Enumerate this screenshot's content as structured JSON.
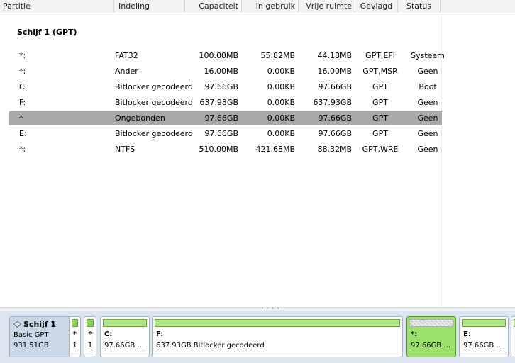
{
  "columns": [
    "Partitie",
    "Indeling",
    "Capaciteit",
    "In gebruik",
    "Vrije ruimte",
    "Gevlagd",
    "Status"
  ],
  "disk_title": "Schijf 1 (GPT)",
  "rows": [
    {
      "partition": "*:",
      "format": "FAT32",
      "capacity": "100.00MB",
      "used": "55.82MB",
      "free": "44.18MB",
      "flags": "GPT,EFI",
      "status": "Systeem",
      "selected": false
    },
    {
      "partition": "*:",
      "format": "Ander",
      "capacity": "16.00MB",
      "used": "0.00KB",
      "free": "16.00MB",
      "flags": "GPT,MSR",
      "status": "Geen",
      "selected": false
    },
    {
      "partition": "C:",
      "format": "Bitlocker gecodeerd",
      "capacity": "97.66GB",
      "used": "0.00KB",
      "free": "97.66GB",
      "flags": "GPT",
      "status": "Boot",
      "selected": false
    },
    {
      "partition": "F:",
      "format": "Bitlocker gecodeerd",
      "capacity": "637.93GB",
      "used": "0.00KB",
      "free": "637.93GB",
      "flags": "GPT",
      "status": "Geen",
      "selected": false
    },
    {
      "partition": "*",
      "format": "Ongebonden",
      "capacity": "97.66GB",
      "used": "0.00KB",
      "free": "97.66GB",
      "flags": "GPT",
      "status": "Geen",
      "selected": true
    },
    {
      "partition": "E:",
      "format": "Bitlocker gecodeerd",
      "capacity": "97.66GB",
      "used": "0.00KB",
      "free": "97.66GB",
      "flags": "GPT",
      "status": "Geen",
      "selected": false
    },
    {
      "partition": "*:",
      "format": "NTFS",
      "capacity": "510.00MB",
      "used": "421.68MB",
      "free": "88.32MB",
      "flags": "GPT,WRE",
      "status": "Geen",
      "selected": false
    }
  ],
  "diskmap": {
    "disk": {
      "name": "Schijf 1",
      "type": "Basic GPT",
      "size": "931.51GB",
      "icon": "disk-icon"
    },
    "partitions": [
      {
        "label": "*",
        "sub": "1"
      },
      {
        "label": "*",
        "sub": "1"
      },
      {
        "label": "C:",
        "sub": "97.66GB ..."
      },
      {
        "label": "F:",
        "sub": "637.93GB Bitlocker gecodeerd"
      },
      {
        "label": "*:",
        "sub": "97.66GB ..."
      },
      {
        "label": "E:",
        "sub": "97.66GB ..."
      }
    ]
  },
  "colors": {
    "selected_row": "#a9a9a9",
    "partition_bar": "#aee388",
    "selected_partition": "#9be06a"
  }
}
